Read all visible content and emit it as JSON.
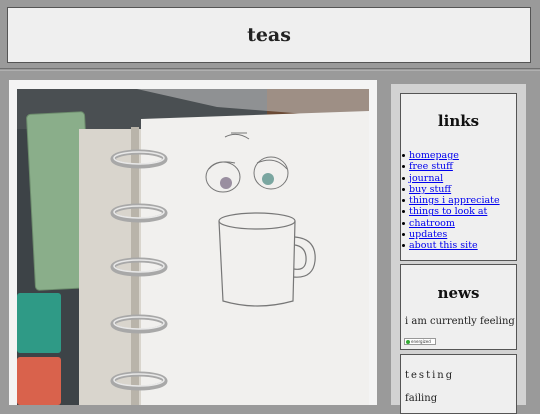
{
  "header": {
    "title": "teas"
  },
  "photo": {
    "icon": "notebook-mug-drawing-photo"
  },
  "sidebar": {
    "links": {
      "title": "links",
      "items": [
        {
          "label": "homepage"
        },
        {
          "label": "free stuff"
        },
        {
          "label": "journal"
        },
        {
          "label": "buy stuff"
        },
        {
          "label": "things i appreciate"
        },
        {
          "label": "things to look at"
        },
        {
          "label": "chatroom"
        },
        {
          "label": "updates"
        },
        {
          "label": "about this site"
        }
      ]
    },
    "news": {
      "title": "news",
      "feeling_text": "i am currently feeling",
      "status_badge": "energized"
    },
    "testing": {
      "title": "testing",
      "status": "failing"
    }
  },
  "colors": {
    "background": "#9a9a9a",
    "panel": "#efefef",
    "link": "#0000ee"
  }
}
